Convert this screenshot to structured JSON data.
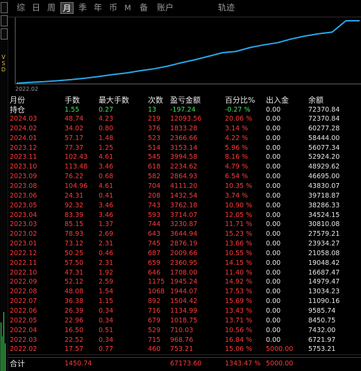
{
  "tabs": [
    "综",
    "日",
    "周",
    "月",
    "季",
    "年",
    "币",
    "M",
    "备",
    "账户",
    "轨迹"
  ],
  "active_tab": "月",
  "chart_data": {
    "type": "line",
    "x_start_label": "2022.02",
    "x": [
      "2022.02",
      "2022.03",
      "2022.04",
      "2022.05",
      "2022.06",
      "2022.07",
      "2022.08",
      "2022.09",
      "2022.10",
      "2022.11",
      "2022.12",
      "2023.01",
      "2023.02",
      "2023.03",
      "2023.04",
      "2023.05",
      "2023.06",
      "2023.08",
      "2023.09",
      "2023.10",
      "2023.11",
      "2023.12",
      "2024.01",
      "2024.02",
      "2024.03",
      "持仓"
    ],
    "y": [
      5753.21,
      6721.97,
      7432.0,
      8450.75,
      9585.74,
      11090.16,
      13034.23,
      14979.47,
      16687.47,
      19048.42,
      21058.08,
      23934.27,
      27579.21,
      30810.08,
      34524.15,
      38286.33,
      39718.87,
      43830.07,
      46695.0,
      48929.62,
      52924.2,
      56077.34,
      58444.0,
      60277.28,
      72370.84,
      72370.84
    ],
    "line_color": "#2aa8ec"
  },
  "table": {
    "headers": [
      "月份",
      "手数",
      "最大手数",
      "次数",
      "盈亏金额",
      "百分比%",
      "出入金",
      "余额"
    ],
    "position_row": {
      "label": "持仓",
      "lots": "1.55",
      "max_lots": "0.27",
      "count": "13",
      "pnl": "-197.24",
      "pct": "-0.27 %",
      "io": "0.00",
      "balance": "72370.84"
    },
    "rows": [
      {
        "month": "2024.03",
        "lots": "48.74",
        "max_lots": "4.23",
        "count": "219",
        "pnl": "12093.56",
        "pct": "20.06 %",
        "io": "0.00",
        "balance": "72370.84"
      },
      {
        "month": "2024.02",
        "lots": "34.02",
        "max_lots": "0.80",
        "count": "376",
        "pnl": "1833.28",
        "pct": "3.14 %",
        "io": "0.00",
        "balance": "60277.28"
      },
      {
        "month": "2024.01",
        "lots": "57.17",
        "max_lots": "1.48",
        "count": "523",
        "pnl": "2366.66",
        "pct": "4.22 %",
        "io": "0.00",
        "balance": "58444.00"
      },
      {
        "month": "2023.12",
        "lots": "77.37",
        "max_lots": "1.25",
        "count": "514",
        "pnl": "3153.14",
        "pct": "5.96 %",
        "io": "0.00",
        "balance": "56077.34"
      },
      {
        "month": "2023.11",
        "lots": "102.43",
        "max_lots": "4.61",
        "count": "545",
        "pnl": "3994.58",
        "pct": "8.16 %",
        "io": "0.00",
        "balance": "52924.20"
      },
      {
        "month": "2023.10",
        "lots": "113.48",
        "max_lots": "3.46",
        "count": "618",
        "pnl": "2234.62",
        "pct": "4.79 %",
        "io": "0.00",
        "balance": "48929.62"
      },
      {
        "month": "2023.09",
        "lots": "76.22",
        "max_lots": "0.68",
        "count": "582",
        "pnl": "2864.93",
        "pct": "6.54 %",
        "io": "0.00",
        "balance": "46695.00"
      },
      {
        "month": "2023.08",
        "lots": "104.96",
        "max_lots": "4.61",
        "count": "704",
        "pnl": "4111.20",
        "pct": "10.35 %",
        "io": "0.00",
        "balance": "43830.07"
      },
      {
        "month": "2023.06",
        "lots": "24.31",
        "max_lots": "0.41",
        "count": "208",
        "pnl": "1432.54",
        "pct": "3.74 %",
        "io": "0.00",
        "balance": "39718.87"
      },
      {
        "month": "2023.05",
        "lots": "92.32",
        "max_lots": "3.46",
        "count": "743",
        "pnl": "3762.18",
        "pct": "10.90 %",
        "io": "0.00",
        "balance": "38286.33"
      },
      {
        "month": "2023.04",
        "lots": "83.39",
        "max_lots": "3.46",
        "count": "593",
        "pnl": "3714.07",
        "pct": "12.05 %",
        "io": "0.00",
        "balance": "34524.15"
      },
      {
        "month": "2023.03",
        "lots": "85.15",
        "max_lots": "1.37",
        "count": "744",
        "pnl": "3230.87",
        "pct": "11.71 %",
        "io": "0.00",
        "balance": "30810.08"
      },
      {
        "month": "2023.02",
        "lots": "78.93",
        "max_lots": "2.69",
        "count": "643",
        "pnl": "3644.94",
        "pct": "15.23 %",
        "io": "0.00",
        "balance": "27579.21"
      },
      {
        "month": "2023.01",
        "lots": "73.12",
        "max_lots": "2.31",
        "count": "745",
        "pnl": "2876.19",
        "pct": "13.66 %",
        "io": "0.00",
        "balance": "23934.27"
      },
      {
        "month": "2022.12",
        "lots": "50.25",
        "max_lots": "0.46",
        "count": "687",
        "pnl": "2009.66",
        "pct": "10.55 %",
        "io": "0.00",
        "balance": "21058.08"
      },
      {
        "month": "2022.11",
        "lots": "57.50",
        "max_lots": "2.31",
        "count": "659",
        "pnl": "2360.95",
        "pct": "14.15 %",
        "io": "0.00",
        "balance": "19048.42"
      },
      {
        "month": "2022.10",
        "lots": "47.31",
        "max_lots": "1.92",
        "count": "646",
        "pnl": "1708.00",
        "pct": "11.40 %",
        "io": "0.00",
        "balance": "16687.47"
      },
      {
        "month": "2022.09",
        "lots": "52.12",
        "max_lots": "2.59",
        "count": "1175",
        "pnl": "1945.24",
        "pct": "14.92 %",
        "io": "0.00",
        "balance": "14979.47"
      },
      {
        "month": "2022.08",
        "lots": "48.08",
        "max_lots": "1.54",
        "count": "1068",
        "pnl": "1944.07",
        "pct": "17.53 %",
        "io": "0.00",
        "balance": "13034.23"
      },
      {
        "month": "2022.07",
        "lots": "36.38",
        "max_lots": "1.15",
        "count": "892",
        "pnl": "1504.42",
        "pct": "15.69 %",
        "io": "0.00",
        "balance": "11090.16"
      },
      {
        "month": "2022.06",
        "lots": "26.39",
        "max_lots": "0.34",
        "count": "716",
        "pnl": "1134.99",
        "pct": "13.43 %",
        "io": "0.00",
        "balance": "9585.74"
      },
      {
        "month": "2022.05",
        "lots": "22.96",
        "max_lots": "0.34",
        "count": "679",
        "pnl": "1018.75",
        "pct": "13.71 %",
        "io": "0.00",
        "balance": "8450.75"
      },
      {
        "month": "2022.04",
        "lots": "16.50",
        "max_lots": "0.51",
        "count": "529",
        "pnl": "710.03",
        "pct": "10.56 %",
        "io": "0.00",
        "balance": "7432.00"
      },
      {
        "month": "2022.03",
        "lots": "22.52",
        "max_lots": "0.34",
        "count": "715",
        "pnl": "968.76",
        "pct": "16.84 %",
        "io": "0.00",
        "balance": "6721.97"
      },
      {
        "month": "2022.02",
        "lots": "17.57",
        "max_lots": "0.77",
        "count": "460",
        "pnl": "753.21",
        "pct": "15.06 %",
        "io": "5000.00",
        "balance": "5753.21"
      }
    ],
    "total_row": {
      "label": "合计",
      "lots": "1450.74",
      "pnl": "67173.60",
      "pct": "1343.47 %",
      "io": "5000.00"
    }
  },
  "left_strip_label": "V S D",
  "colors": {
    "profit": "#ff3a3a",
    "position": "#3fe45a",
    "line": "#2aa8ec"
  }
}
